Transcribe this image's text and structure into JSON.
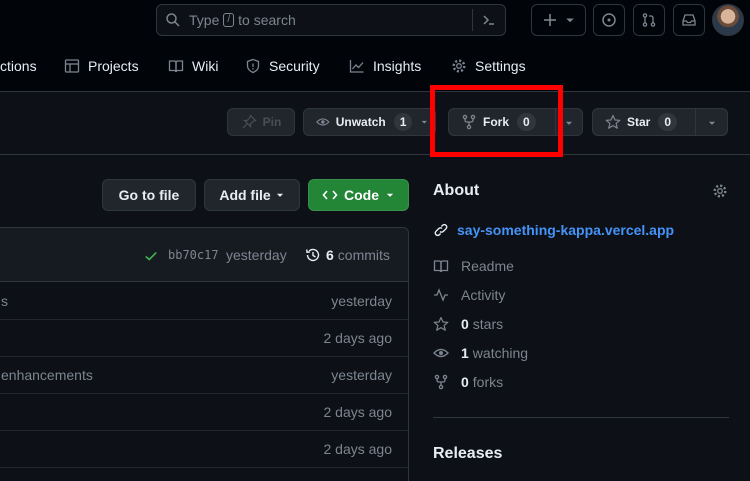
{
  "topbar": {
    "search_prefix": "Type",
    "search_key": "/",
    "search_suffix": "to search"
  },
  "repo_nav": {
    "items": [
      {
        "label": "ctions",
        "icon": "play-icon"
      },
      {
        "label": "Projects",
        "icon": "table-icon"
      },
      {
        "label": "Wiki",
        "icon": "book-icon"
      },
      {
        "label": "Security",
        "icon": "shield-icon"
      },
      {
        "label": "Insights",
        "icon": "graph-icon"
      },
      {
        "label": "Settings",
        "icon": "gear-icon"
      }
    ]
  },
  "repo_actions": {
    "pin_label": "Pin",
    "unwatch_label": "Unwatch",
    "unwatch_count": "1",
    "fork_label": "Fork",
    "fork_count": "0",
    "star_label": "Star",
    "star_count": "0"
  },
  "file_actions": {
    "go_to_file": "Go to file",
    "add_file": "Add file",
    "code": "Code"
  },
  "commit_bar": {
    "sha": "bb70c17",
    "time": "yesterday",
    "commits_count": "6",
    "commits_label": "commits"
  },
  "file_rows": [
    {
      "message": "s",
      "age": "yesterday"
    },
    {
      "message": "",
      "age": "2 days ago"
    },
    {
      "message": "enhancements",
      "age": "yesterday"
    },
    {
      "message": "",
      "age": "2 days ago"
    },
    {
      "message": "",
      "age": "2 days ago"
    }
  ],
  "about": {
    "title": "About",
    "link": "say-something-kappa.vercel.app",
    "readme": "Readme",
    "activity": "Activity",
    "stars_count": "0",
    "stars_label": "stars",
    "watching_count": "1",
    "watching_label": "watching",
    "forks_count": "0",
    "forks_label": "forks"
  },
  "releases": {
    "title": "Releases"
  },
  "colors": {
    "background": "#0d1117",
    "accent_green": "#238636",
    "link_blue": "#4493f8",
    "highlight_red": "#ff0000"
  }
}
